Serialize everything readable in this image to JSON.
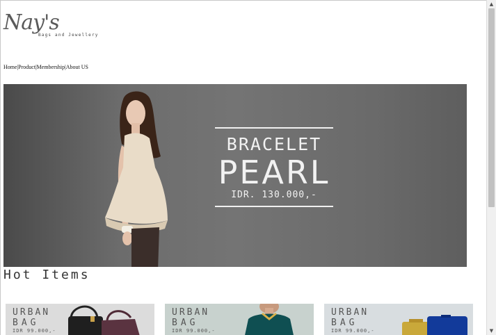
{
  "logo": {
    "script_text": "Nay's",
    "tagline": "Bags and Jewellery"
  },
  "nav": {
    "items": [
      {
        "label": "Home"
      },
      {
        "label": "Product"
      },
      {
        "label": "Membership"
      },
      {
        "label": "About US"
      }
    ],
    "separator": "|"
  },
  "banner": {
    "line1": "BRACELET",
    "line2": "PEARL",
    "price": "IDR. 130.000,-"
  },
  "section": {
    "title": "Hot Items"
  },
  "products": [
    {
      "line1": "URBAN",
      "line2": "BAG",
      "price": "IDR 99.000,-"
    },
    {
      "line1": "URBAN",
      "line2": "BAG",
      "price": "IDR 99.000,-"
    },
    {
      "line1": "URBAN",
      "line2": "BAG",
      "price": "IDR 99.000,-"
    }
  ],
  "scrollbar": {
    "up_glyph": "▲",
    "down_glyph": "▼"
  },
  "colors": {
    "banner_gray": "#6c6c6c",
    "text_dark": "#333333",
    "card1_bg": "#dcdcdc",
    "card2_bg": "#cfd8d4",
    "card3_bg": "#d8dde0"
  }
}
